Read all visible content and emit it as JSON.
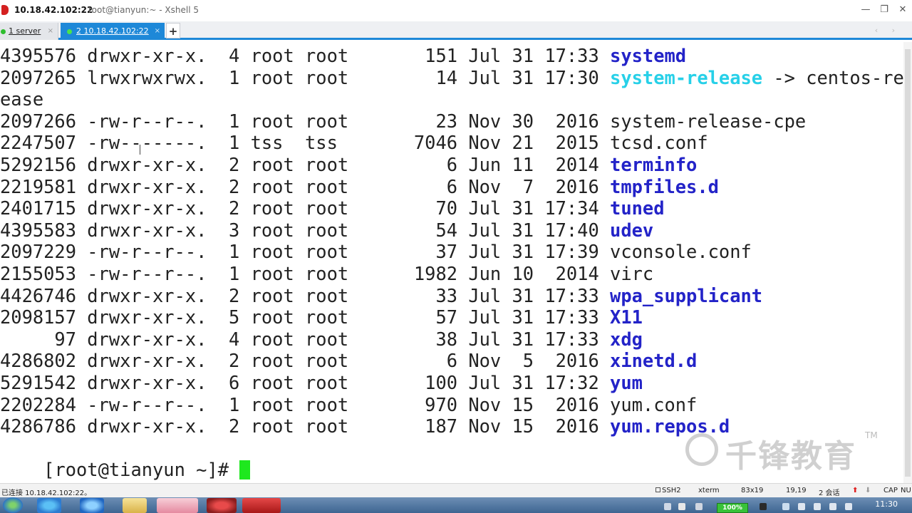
{
  "window": {
    "host": "10.18.42.102:22",
    "app_title": "root@tianyun:~ - Xshell 5",
    "min_label": "—",
    "restore_label": "❐",
    "close_label": "✕"
  },
  "tabs": [
    {
      "label": "1 server",
      "close": "×"
    },
    {
      "label": "2 10.18.42.102:22",
      "close": "×"
    }
  ],
  "tab_add_label": "+",
  "nav_arrows": "‹ ›",
  "terminal": {
    "lines": [
      {
        "meta": "4395576 drwxr-xr-x.  4 root root       151 Jul 31 17:33 ",
        "name": "systemd",
        "style": "dir"
      },
      {
        "meta": "2097265 lrwxrwxrwx.  1 root root        14 Jul 31 17:30 ",
        "name": "system-release",
        "style": "link",
        "suffix": " -> centos-rel"
      },
      {
        "meta": "ease",
        "name": "",
        "style": "plain"
      },
      {
        "meta": "2097266 -rw-r--r--.  1 root root        23 Nov 30  2016 ",
        "name": "system-release-cpe",
        "style": "plain"
      },
      {
        "meta": "2247507 -rw-------.  1 tss  tss       7046 Nov 21  2015 ",
        "name": "tcsd.conf",
        "style": "plain"
      },
      {
        "meta": "5292156 drwxr-xr-x.  2 root root         6 Jun 11  2014 ",
        "name": "terminfo",
        "style": "dir"
      },
      {
        "meta": "2219581 drwxr-xr-x.  2 root root         6 Nov  7  2016 ",
        "name": "tmpfiles.d",
        "style": "dir"
      },
      {
        "meta": "2401715 drwxr-xr-x.  2 root root        70 Jul 31 17:34 ",
        "name": "tuned",
        "style": "dir"
      },
      {
        "meta": "4395583 drwxr-xr-x.  3 root root        54 Jul 31 17:40 ",
        "name": "udev",
        "style": "dir"
      },
      {
        "meta": "2097229 -rw-r--r--.  1 root root        37 Jul 31 17:39 ",
        "name": "vconsole.conf",
        "style": "plain"
      },
      {
        "meta": "2155053 -rw-r--r--.  1 root root      1982 Jun 10  2014 ",
        "name": "virc",
        "style": "plain"
      },
      {
        "meta": "4426746 drwxr-xr-x.  2 root root        33 Jul 31 17:33 ",
        "name": "wpa_supplicant",
        "style": "dir"
      },
      {
        "meta": "2098157 drwxr-xr-x.  5 root root        57 Jul 31 17:33 ",
        "name": "X11",
        "style": "dir"
      },
      {
        "meta": "     97 drwxr-xr-x.  4 root root        38 Jul 31 17:33 ",
        "name": "xdg",
        "style": "dir"
      },
      {
        "meta": "4286802 drwxr-xr-x.  2 root root         6 Nov  5  2016 ",
        "name": "xinetd.d",
        "style": "dir"
      },
      {
        "meta": "5291542 drwxr-xr-x.  6 root root       100 Jul 31 17:32 ",
        "name": "yum",
        "style": "dir"
      },
      {
        "meta": "2202284 -rw-r--r--.  1 root root       970 Nov 15  2016 ",
        "name": "yum.conf",
        "style": "plain"
      },
      {
        "meta": "4286786 drwxr-xr-x.  2 root root       187 Nov 15  2016 ",
        "name": "yum.repos.d",
        "style": "dir"
      }
    ],
    "prompt": "[root@tianyun ~]# ",
    "colors": {
      "dir": "#2323c8",
      "link": "#27d0e8",
      "cursor": "#1ee81e"
    }
  },
  "watermark": {
    "text": "千锋教育",
    "tm": "TM"
  },
  "statusbar": {
    "connection": "已连接 10.18.42.102:22。",
    "protocol": "SSH2",
    "term": "xterm",
    "size": "83x19",
    "position": "19,19",
    "sessions": "2 会话",
    "caps": "CAP",
    "num": "NU"
  },
  "taskbar": {
    "battery": "100%",
    "clock": "11:30"
  }
}
